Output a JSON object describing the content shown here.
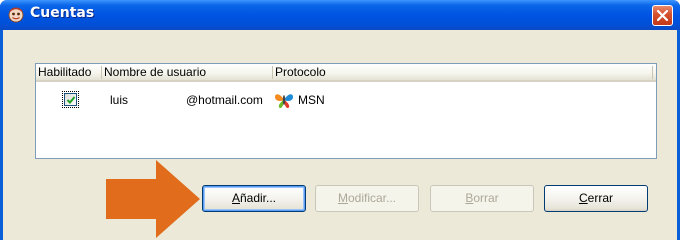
{
  "window": {
    "title": "Cuentas",
    "title_icon": "accounts-icon",
    "close_icon": "close-icon",
    "colors": {
      "titlebar": "#0054e3",
      "frame": "#0a5fd8",
      "client": "#ece9d8",
      "close": "#d4502c"
    }
  },
  "list": {
    "columns": [
      "Habilitado",
      "Nombre de usuario",
      "Protocolo"
    ],
    "rows": [
      {
        "enabled": true,
        "username": "luis",
        "domain": "@hotmail.com",
        "protocol": "MSN",
        "protocol_icon": "msn-butterfly-icon"
      }
    ]
  },
  "buttons": {
    "add": {
      "prefix": "",
      "mnemonic": "A",
      "rest": "ñadir...",
      "enabled": true
    },
    "modify": {
      "prefix": "",
      "mnemonic": "M",
      "rest": "odificar...",
      "enabled": false
    },
    "delete": {
      "prefix": "",
      "mnemonic": "B",
      "rest": "orrar",
      "enabled": false
    },
    "close": {
      "prefix": "",
      "mnemonic": "C",
      "rest": "errar",
      "enabled": true
    }
  },
  "annotation": {
    "icon": "arrow-right-icon",
    "color": "#e06c1c"
  }
}
